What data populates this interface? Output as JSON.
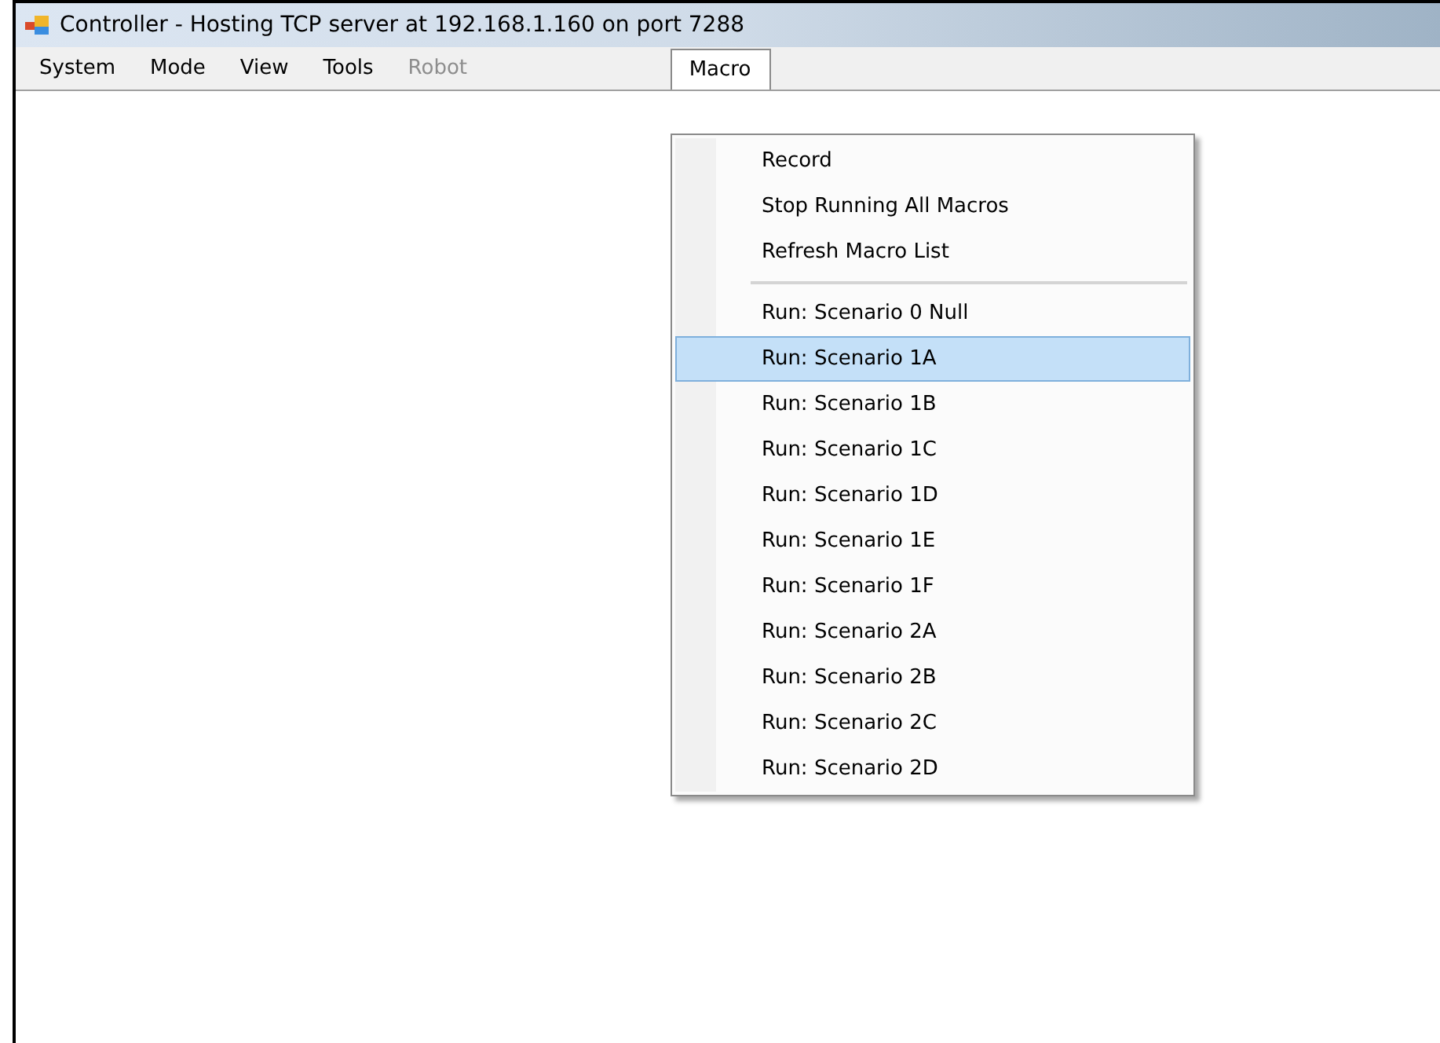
{
  "window": {
    "title": "Controller - Hosting TCP server at 192.168.1.160 on port 7288"
  },
  "menu_bar": [
    {
      "label": "System",
      "disabled": false,
      "selected": false
    },
    {
      "label": "Mode",
      "disabled": false,
      "selected": false
    },
    {
      "label": "View",
      "disabled": false,
      "selected": false
    },
    {
      "label": "Tools",
      "disabled": false,
      "selected": false
    },
    {
      "label": "Robot",
      "disabled": true,
      "selected": false
    },
    {
      "label": "Macro",
      "disabled": false,
      "selected": true
    }
  ],
  "dropdown": {
    "items": [
      {
        "kind": "item",
        "label": "Record",
        "selected": false
      },
      {
        "kind": "item",
        "label": "Stop Running All Macros",
        "selected": false
      },
      {
        "kind": "item",
        "label": "Refresh Macro List",
        "selected": false
      },
      {
        "kind": "separator"
      },
      {
        "kind": "item",
        "label": "Run: Scenario 0 Null",
        "selected": false
      },
      {
        "kind": "item",
        "label": "Run: Scenario 1A",
        "selected": true
      },
      {
        "kind": "item",
        "label": "Run: Scenario 1B",
        "selected": false
      },
      {
        "kind": "item",
        "label": "Run: Scenario 1C",
        "selected": false
      },
      {
        "kind": "item",
        "label": "Run: Scenario 1D",
        "selected": false
      },
      {
        "kind": "item",
        "label": "Run: Scenario 1E",
        "selected": false
      },
      {
        "kind": "item",
        "label": "Run: Scenario 1F",
        "selected": false
      },
      {
        "kind": "item",
        "label": "Run: Scenario 2A",
        "selected": false
      },
      {
        "kind": "item",
        "label": "Run: Scenario 2B",
        "selected": false
      },
      {
        "kind": "item",
        "label": "Run: Scenario 2C",
        "selected": false
      },
      {
        "kind": "item",
        "label": "Run: Scenario 2D",
        "selected": false
      }
    ]
  }
}
